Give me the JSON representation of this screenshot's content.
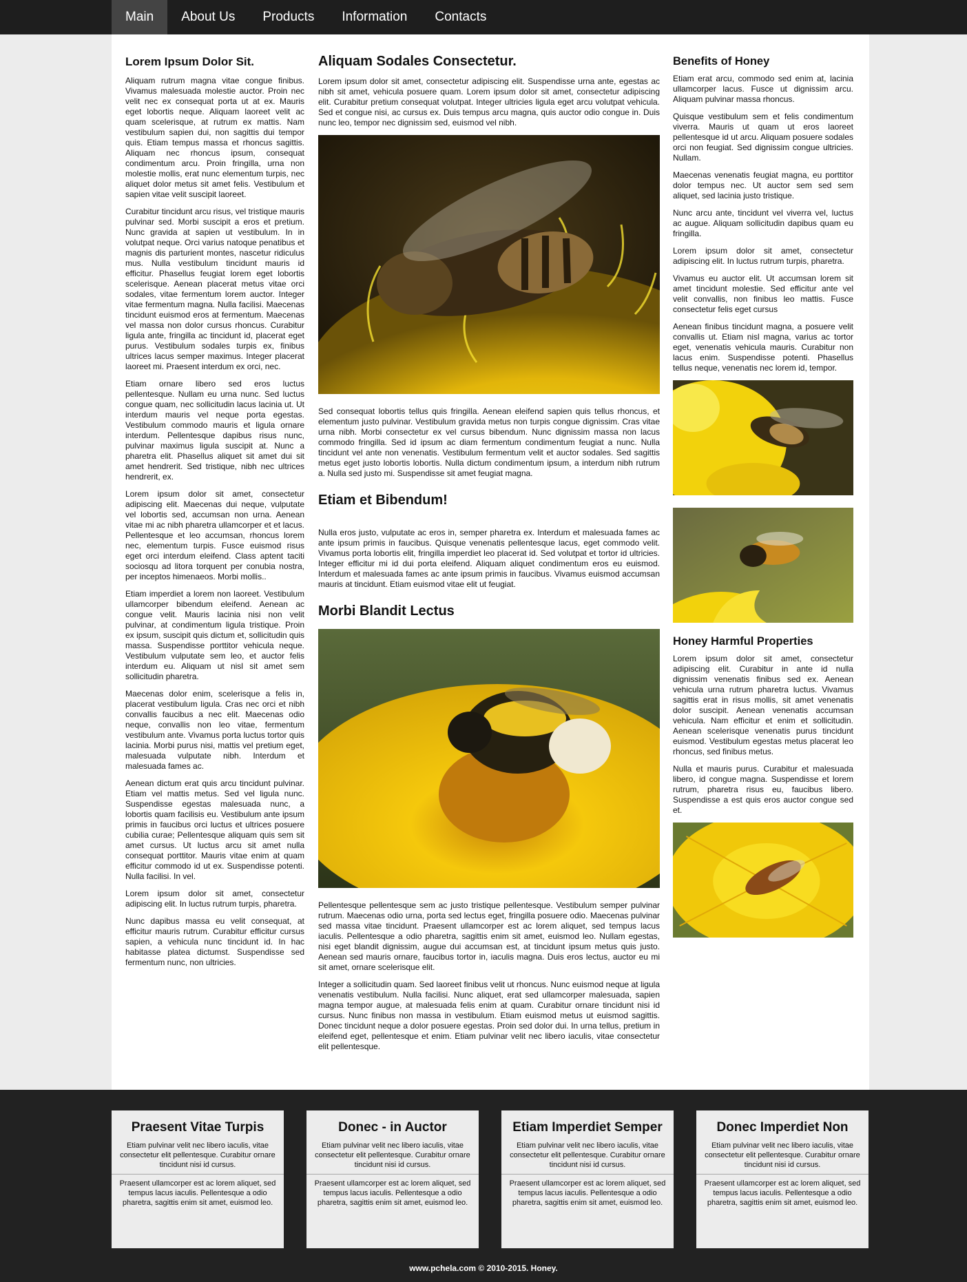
{
  "nav": {
    "items": [
      "Main",
      "About Us",
      "Products",
      "Information",
      "Contacts"
    ]
  },
  "left": {
    "title": "Lorem Ipsum Dolor Sit.",
    "paragraphs": [
      "Aliquam rutrum magna vitae congue finibus. Vivamus malesuada molestie auctor. Proin nec velit nec ex consequat porta ut at ex. Mauris eget lobortis neque. Aliquam laoreet velit ac quam scelerisque, at rutrum ex mattis. Nam vestibulum sapien dui, non sagittis dui tempor quis. Etiam tempus massa et rhoncus sagittis. Aliquam nec rhoncus ipsum, consequat condimentum arcu. Proin fringilla, urna non molestie mollis, erat nunc elementum turpis, nec aliquet dolor metus sit amet felis. Vestibulum et sapien vitae velit suscipit laoreet.",
      "Curabitur tincidunt arcu risus, vel tristique mauris pulvinar sed. Morbi suscipit a eros et pretium. Nunc gravida at sapien ut vestibulum. In in volutpat neque. Orci varius natoque penatibus et magnis dis parturient montes, nascetur ridiculus mus. Nulla vestibulum tincidunt mauris id efficitur. Phasellus feugiat lorem eget lobortis scelerisque. Aenean placerat metus vitae orci sodales, vitae fermentum lorem auctor. Integer vitae fermentum magna. Nulla facilisi. Maecenas tincidunt euismod eros at fermentum. Maecenas vel massa non dolor cursus rhoncus. Curabitur ligula ante, fringilla ac tincidunt id, placerat eget purus. Vestibulum sodales turpis ex, finibus ultrices lacus semper maximus. Integer placerat laoreet mi. Praesent interdum ex orci, nec.",
      "Etiam ornare libero sed eros luctus pellentesque. Nullam eu urna nunc. Sed luctus congue quam, nec sollicitudin lacus lacinia ut. Ut interdum mauris vel neque porta egestas. Vestibulum commodo mauris et ligula ornare interdum. Pellentesque dapibus risus nunc, pulvinar maximus ligula suscipit at. Nunc a pharetra elit. Phasellus aliquet sit amet dui sit amet hendrerit. Sed tristique, nibh nec ultrices hendrerit, ex.",
      "Lorem ipsum dolor sit amet, consectetur adipiscing elit. Maecenas dui neque, vulputate vel lobortis sed, accumsan non urna. Aenean vitae mi ac nibh pharetra ullamcorper et et lacus. Pellentesque et leo accumsan, rhoncus lorem nec, elementum turpis. Fusce euismod risus eget orci interdum eleifend. Class aptent taciti sociosqu ad litora torquent per conubia nostra, per inceptos himenaeos. Morbi mollis..",
      "Etiam imperdiet a lorem non laoreet. Vestibulum ullamcorper bibendum eleifend. Aenean ac congue velit. Mauris lacinia nisi non velit pulvinar, at condimentum ligula tristique. Proin ex ipsum, suscipit quis dictum et, sollicitudin quis massa. Suspendisse porttitor vehicula neque. Vestibulum vulputate sem leo, et auctor felis interdum eu. Aliquam ut nisl sit amet sem sollicitudin pharetra.",
      "Maecenas dolor enim, scelerisque a felis in, placerat vestibulum ligula. Cras nec orci et nibh convallis faucibus a nec elit. Maecenas odio neque, convallis non leo vitae, fermentum vestibulum ante. Vivamus porta luctus tortor quis lacinia. Morbi purus nisi, mattis vel pretium eget, malesuada vulputate nibh. Interdum et malesuada fames ac.",
      "Aenean dictum erat quis arcu tincidunt pulvinar. Etiam vel mattis metus. Sed vel ligula nunc. Suspendisse egestas malesuada nunc, a lobortis quam facilisis eu. Vestibulum ante ipsum primis in faucibus orci luctus et ultrices posuere cubilia curae; Pellentesque aliquam quis sem sit amet cursus. Ut luctus arcu sit amet nulla consequat porttitor. Mauris vitae enim at quam efficitur commodo id ut ex. Suspendisse potenti. Nulla facilisi. In vel.",
      "Lorem ipsum dolor sit amet, consectetur adipiscing elit. In luctus rutrum turpis, pharetra.",
      "Nunc dapibus massa eu velit consequat, at efficitur mauris rutrum. Curabitur efficitur cursus sapien, a vehicula nunc tincidunt id. In hac habitasse platea dictumst. Suspendisse sed fermentum nunc, non ultricies."
    ]
  },
  "middle": {
    "title": "Aliquam Sodales Consectetur.",
    "intro": "Lorem ipsum dolor sit amet, consectetur adipiscing elit. Suspendisse urna ante, egestas ac nibh sit amet, vehicula posuere quam. Lorem ipsum dolor sit amet, consectetur adipiscing elit. Curabitur pretium consequat volutpat. Integer ultricies ligula eget arcu volutpat vehicula. Sed et congue nisi, ac cursus ex. Duis tempus arcu magna, quis auctor odio congue in. Duis nunc leo, tempor nec dignissim sed, euismod vel nibh.",
    "after_image": "Sed consequat lobortis tellus quis fringilla. Aenean eleifend sapien quis tellus rhoncus, et elementum justo pulvinar. Vestibulum gravida metus non turpis congue dignissim. Cras vitae urna nibh. Morbi consectetur ex vel cursus bibendum. Nunc dignissim massa non lacus commodo fringilla. Sed id ipsum ac diam fermentum condimentum feugiat a nunc. Nulla tincidunt vel ante non venenatis. Vestibulum fermentum velit et auctor sodales. Sed sagittis metus eget justo lobortis lobortis. Nulla dictum condimentum ipsum, a interdum nibh rutrum a. Nulla sed justo mi. Suspendisse sit amet feugiat magna.",
    "subtitle1": "Etiam et Bibendum!",
    "sub1_text": "Nulla eros justo, vulputate ac eros in, semper pharetra ex. Interdum et malesuada fames ac ante ipsum primis in faucibus. Quisque venenatis pellentesque lacus, eget commodo velit. Vivamus porta lobortis elit, fringilla imperdiet leo placerat id. Sed volutpat et tortor id ultricies. Integer efficitur mi id dui porta eleifend. Aliquam aliquet condimentum eros eu euismod. Interdum et malesuada fames ac ante ipsum primis in faucibus. Vivamus euismod accumsan mauris at tincidunt. Etiam euismod vitae elit ut feugiat.",
    "subtitle2": "Morbi Blandit Lectus",
    "sub2_text1": "Pellentesque pellentesque sem ac justo tristique pellentesque. Vestibulum semper pulvinar rutrum. Maecenas odio urna, porta sed lectus eget, fringilla posuere odio. Maecenas pulvinar sed massa vitae tincidunt. Praesent ullamcorper est ac lorem aliquet, sed tempus lacus iaculis. Pellentesque a odio pharetra, sagittis enim sit amet, euismod leo. Nullam egestas, nisi eget blandit dignissim, augue dui accumsan est, at tincidunt ipsum metus quis justo. Aenean sed mauris ornare, faucibus tortor in, iaculis magna. Duis eros lectus, auctor eu mi sit amet, ornare scelerisque elit.",
    "sub2_text2": "Integer a sollicitudin quam. Sed laoreet finibus velit ut rhoncus. Nunc euismod neque at ligula venenatis vestibulum. Nulla facilisi. Nunc aliquet, erat sed ullamcorper malesuada, sapien magna tempor augue, at malesuada felis enim at quam. Curabitur ornare tincidunt nisi id cursus. Nunc finibus non massa in vestibulum. Etiam euismod metus ut euismod sagittis. Donec tincidunt neque a dolor posuere egestas. Proin sed dolor dui. In urna tellus, pretium in eleifend eget, pellentesque et enim. Etiam pulvinar velit nec libero iaculis, vitae consectetur elit pellentesque."
  },
  "right": {
    "title": "Benefits of Honey",
    "paragraphs": [
      "Etiam erat arcu, commodo sed enim at, lacinia ullamcorper lacus. Fusce ut dignissim arcu. Aliquam pulvinar massa rhoncus.",
      "Quisque vestibulum sem et felis condimentum viverra. Mauris ut quam ut eros laoreet pellentesque id ut arcu. Aliquam posuere sodales orci non feugiat. Sed dignissim congue ultricies. Nullam.",
      "Maecenas venenatis feugiat magna, eu porttitor dolor tempus nec. Ut auctor sem sed sem aliquet, sed lacinia justo tristique.",
      "Nunc arcu ante, tincidunt vel viverra vel, luctus ac augue. Aliquam sollicitudin dapibus quam eu fringilla.",
      "Lorem ipsum dolor sit amet, consectetur adipiscing elit. In luctus rutrum turpis, pharetra.",
      "Vivamus eu auctor elit. Ut accumsan lorem sit amet tincidunt molestie. Sed efficitur ante vel velit convallis, non finibus leo mattis. Fusce consectetur felis eget cursus",
      "Aenean finibus tincidunt magna, a posuere velit convallis ut. Etiam nisl magna, varius ac tortor eget, venenatis vehicula mauris. Curabitur non lacus enim. Suspendisse potenti. Phasellus tellus neque, venenatis nec lorem id, tempor."
    ],
    "title2": "Honey Harmful Properties",
    "paragraphs2": [
      "Lorem ipsum dolor sit amet, consectetur adipiscing elit. Curabitur in ante id nulla dignissim venenatis finibus sed ex. Aenean vehicula urna rutrum pharetra luctus. Vivamus sagittis erat in risus mollis, sit amet venenatis dolor suscipit. Aenean venenatis accumsan vehicula. Nam efficitur et enim et sollicitudin. Aenean scelerisque venenatis purus tincidunt euismod. Vestibulum egestas metus placerat leo rhoncus, sed finibus metus.",
      "Nulla et mauris purus. Curabitur et malesuada libero, id congue magna. Suspendisse et lorem rutrum, pharetra risus eu, faucibus libero. Suspendisse a est quis eros auctor congue sed et."
    ]
  },
  "footer": {
    "boxes": [
      {
        "title": "Praesent Vitae Turpis",
        "text1": "Etiam pulvinar velit nec libero iaculis, vitae consectetur elit pellentesque. Curabitur ornare tincidunt nisi id cursus.",
        "text2": "Praesent ullamcorper est ac lorem aliquet, sed tempus lacus iaculis. Pellentesque a odio pharetra, sagittis enim sit amet, euismod leo."
      },
      {
        "title": "Donec - in Auctor",
        "text1": "Etiam pulvinar velit nec libero iaculis, vitae consectetur elit pellentesque. Curabitur ornare tincidunt nisi id cursus.",
        "text2": "Praesent ullamcorper est ac lorem aliquet, sed tempus lacus iaculis. Pellentesque a odio pharetra, sagittis enim sit amet, euismod leo."
      },
      {
        "title": "Etiam Imperdiet Semper",
        "text1": "Etiam pulvinar velit nec libero iaculis, vitae consectetur elit pellentesque. Curabitur ornare tincidunt nisi id cursus.",
        "text2": "Praesent ullamcorper est ac lorem aliquet, sed tempus lacus iaculis. Pellentesque a odio pharetra, sagittis enim sit amet, euismod leo."
      },
      {
        "title": "Donec Imperdiet Non",
        "text1": "Etiam pulvinar velit nec libero iaculis, vitae consectetur elit pellentesque. Curabitur ornare tincidunt nisi id cursus.",
        "text2": "Praesent ullamcorper est ac lorem aliquet, sed tempus lacus iaculis. Pellentesque a odio pharetra, sagittis enim sit amet, euismod leo."
      }
    ],
    "copyright": "www.pchela.com © 2010-2015. Honey."
  },
  "colors": {
    "nav_bg": "#1e1e1e",
    "nav_active": "#444444",
    "footer_bg": "#222222",
    "box_bg": "#ececec",
    "flower_yellow": "#f2d40a"
  },
  "images": [
    "bee-on-dandelion-photo",
    "bee-on-yellow-flower-photo",
    "bee-flying-photo",
    "bumblebee-on-yellow-flower-photo",
    "bee-on-dandelion-photo-2"
  ]
}
